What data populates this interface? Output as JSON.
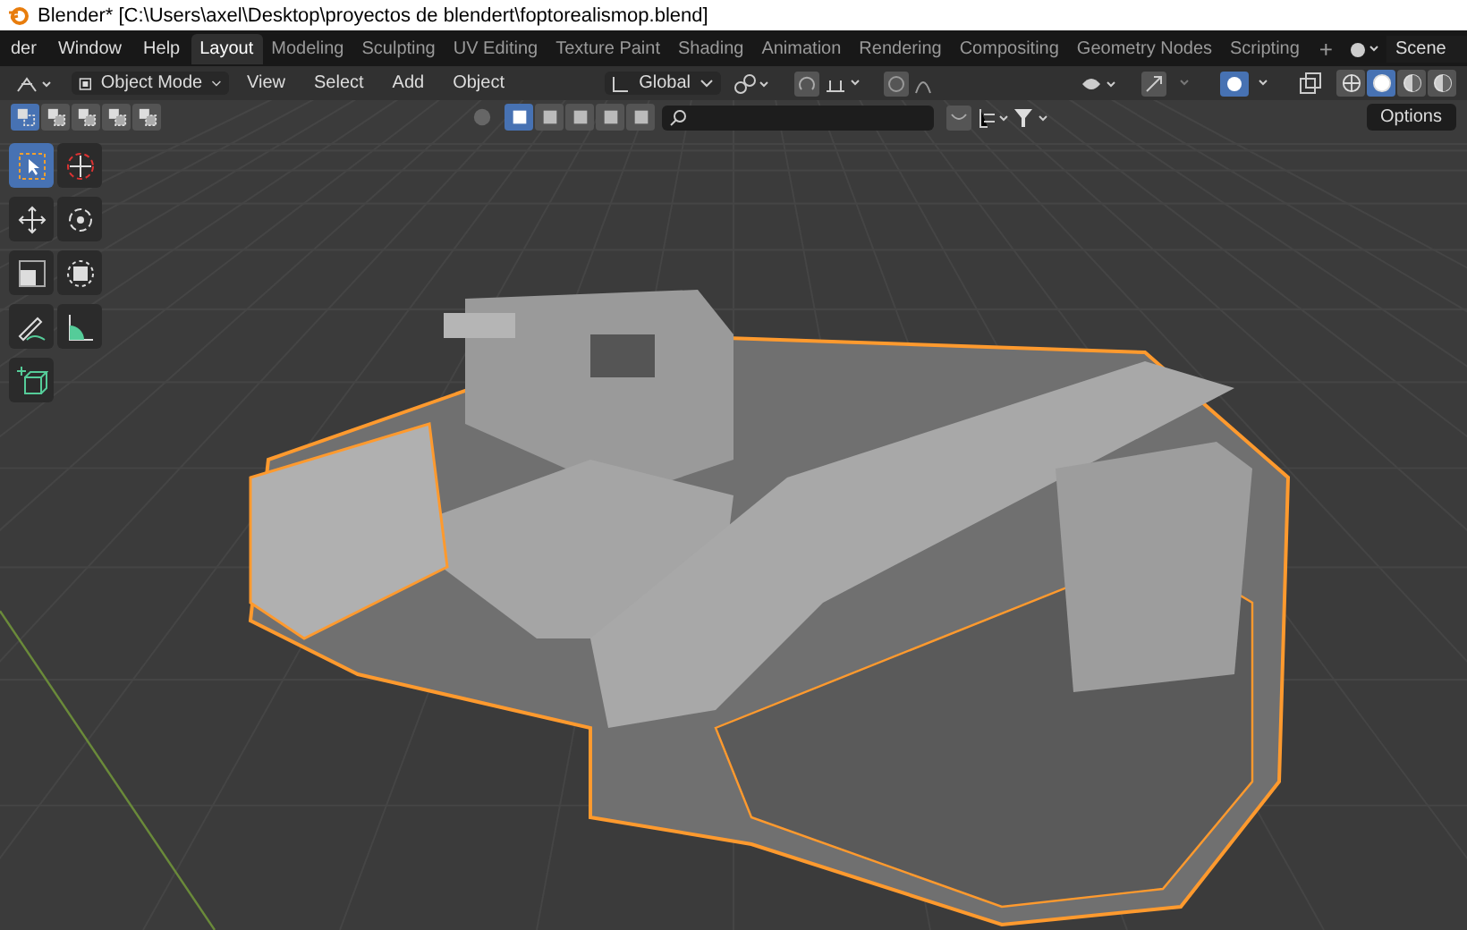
{
  "window": {
    "title": "Blender* [C:\\Users\\axel\\Desktop\\proyectos de blendert\\foptorealismop.blend]"
  },
  "menu": [
    "der",
    "Window",
    "Help"
  ],
  "workspace_tabs": [
    {
      "label": "Layout",
      "selected": true
    },
    {
      "label": "Modeling",
      "selected": false
    },
    {
      "label": "Sculpting",
      "selected": false
    },
    {
      "label": "UV Editing",
      "selected": false
    },
    {
      "label": "Texture Paint",
      "selected": false
    },
    {
      "label": "Shading",
      "selected": false
    },
    {
      "label": "Animation",
      "selected": false
    },
    {
      "label": "Rendering",
      "selected": false
    },
    {
      "label": "Compositing",
      "selected": false
    },
    {
      "label": "Geometry Nodes",
      "selected": false
    },
    {
      "label": "Scripting",
      "selected": false
    }
  ],
  "add_tab": "+",
  "scene": {
    "name": "Scene"
  },
  "header": {
    "mode": "Object Mode",
    "menus": [
      "View",
      "Select",
      "Add",
      "Object"
    ],
    "orientation": "Global"
  },
  "select_modes": [
    {
      "selected": true
    },
    {
      "selected": false
    },
    {
      "selected": false
    },
    {
      "selected": false
    },
    {
      "selected": false
    }
  ],
  "shading_modes": [
    {
      "selected": false
    },
    {
      "selected": true
    },
    {
      "selected": false
    },
    {
      "selected": false
    }
  ],
  "options": "Options",
  "tools": [
    {
      "kind": "select",
      "selected": true
    },
    {
      "kind": "cursor",
      "selected": false
    },
    {
      "kind": "move",
      "selected": false
    },
    {
      "kind": "rotate",
      "selected": false
    },
    {
      "kind": "scale",
      "selected": false
    },
    {
      "kind": "transform",
      "selected": false
    },
    {
      "kind": "annotate",
      "selected": false
    },
    {
      "kind": "measure",
      "selected": false
    },
    {
      "kind": "add-cube",
      "selected": false
    }
  ]
}
